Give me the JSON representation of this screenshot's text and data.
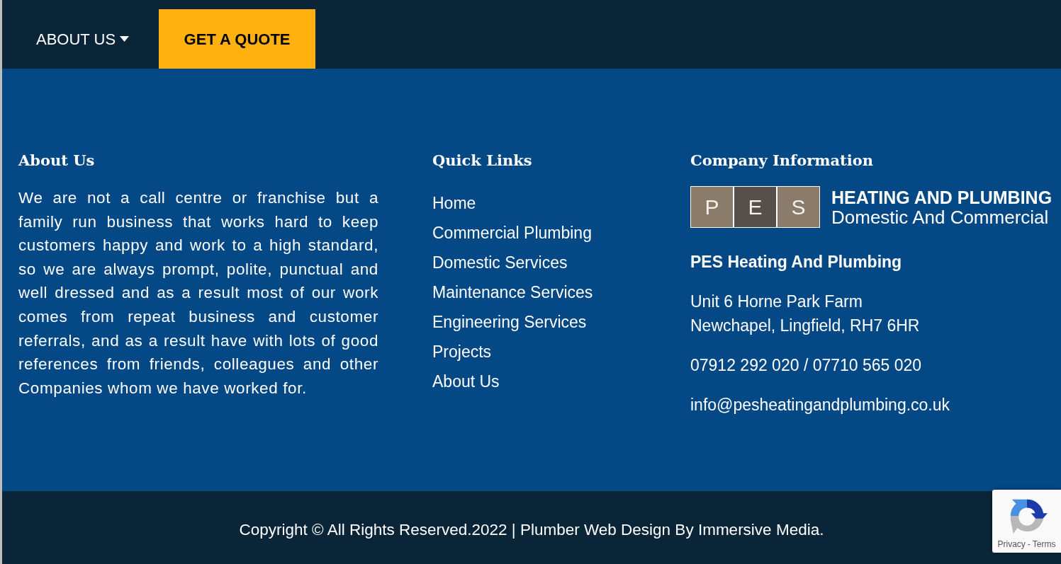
{
  "nav": {
    "items": [
      {
        "kind": "dropdown",
        "label": "ABOUT US"
      },
      {
        "kind": "cta",
        "label": "GET A QUOTE"
      }
    ]
  },
  "footer": {
    "about": {
      "heading": "About Us",
      "text": "We are not a call centre or franchise but a family run business that works hard to keep customers happy and work to a high standard, so we are always prompt, polite, punctual and well dressed and as a result most of our work comes from repeat business and customer referrals, and as a result have with lots of good references from friends, colleagues and other Companies whom we have worked for."
    },
    "quick_links": {
      "heading": "Quick Links",
      "links": [
        "Home",
        "Commercial Plumbing",
        "Domestic Services",
        "Maintenance Services",
        "Engineering Services",
        "Projects",
        "About Us"
      ]
    },
    "company": {
      "heading": "Company Information",
      "logo": {
        "tiles": [
          {
            "letter": "P",
            "color": "#8b7b6b"
          },
          {
            "letter": "E",
            "color": "#57504a"
          },
          {
            "letter": "S",
            "color": "#8b7b6b"
          }
        ],
        "title": "HEATING AND PLUMBING",
        "subtitle": "Domestic And Commercial"
      },
      "name": "PES Heating And Plumbing",
      "address_lines": [
        "Unit 6 Horne Park Farm",
        "Newchapel, Lingfield, RH7 6HR"
      ],
      "phone": "07912 292 020 / 07710 565 020",
      "email": "info@pesheatingandplumbing.co.uk"
    }
  },
  "copyright": "Copyright © All Rights Reserved.2022 | Plumber Web Design By Immersive Media.",
  "recaptcha": {
    "links": [
      "Privacy",
      "Terms"
    ],
    "separator": "-"
  }
}
